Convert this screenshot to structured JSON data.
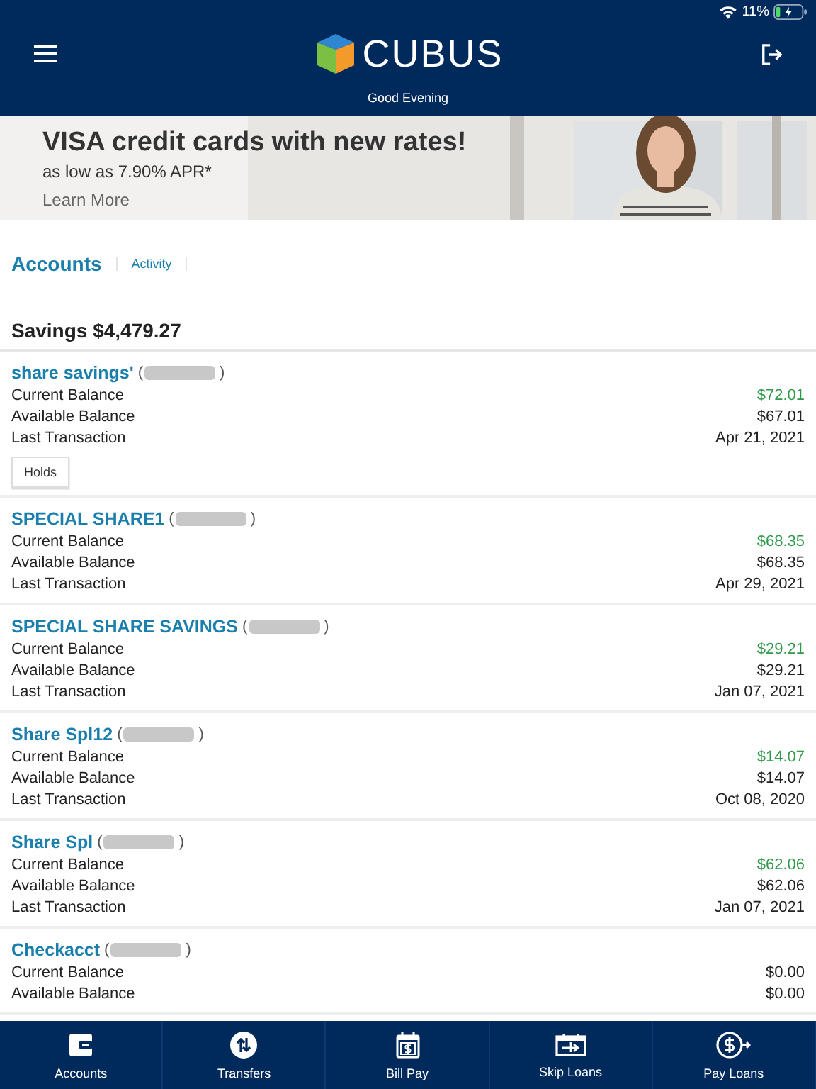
{
  "status_bar": {
    "battery": "11%"
  },
  "header": {
    "logo_text": "CUBUS",
    "greeting": "Good Evening"
  },
  "banner": {
    "headline": "VISA credit cards with new rates!",
    "subline": "as low as 7.90% APR*",
    "link": "Learn More",
    "kind": "picture"
  },
  "tabs": [
    {
      "label": "Accounts",
      "selected": true
    },
    {
      "label": "Activity",
      "selected": false
    }
  ],
  "section_title": "Savings $4,479.27",
  "accounts": [
    {
      "name": "share savings'",
      "open": "(",
      "close": ")",
      "rows": [
        {
          "label": "Current Balance",
          "value": "$72.01",
          "positive": true
        },
        {
          "label": "Available Balance",
          "value": "$67.01",
          "positive": false
        },
        {
          "label": "Last Transaction",
          "value": "Apr 21, 2021",
          "positive": false
        }
      ],
      "button": "Holds"
    },
    {
      "name": "SPECIAL SHARE1",
      "open": "(",
      "close": ")",
      "rows": [
        {
          "label": "Current Balance",
          "value": "$68.35",
          "positive": true
        },
        {
          "label": "Available Balance",
          "value": "$68.35",
          "positive": false
        },
        {
          "label": "Last Transaction",
          "value": "Apr 29, 2021",
          "positive": false
        }
      ]
    },
    {
      "name": "SPECIAL SHARE SAVINGS",
      "open": "(",
      "close": ")",
      "rows": [
        {
          "label": "Current Balance",
          "value": "$29.21",
          "positive": true
        },
        {
          "label": "Available Balance",
          "value": "$29.21",
          "positive": false
        },
        {
          "label": "Last Transaction",
          "value": "Jan 07, 2021",
          "positive": false
        }
      ]
    },
    {
      "name": "Share Spl12",
      "open": "(",
      "close": ")",
      "rows": [
        {
          "label": "Current Balance",
          "value": "$14.07",
          "positive": true
        },
        {
          "label": "Available Balance",
          "value": "$14.07",
          "positive": false
        },
        {
          "label": "Last Transaction",
          "value": "Oct 08, 2020",
          "positive": false
        }
      ]
    },
    {
      "name": "Share Spl",
      "open": "(",
      "close": ")",
      "rows": [
        {
          "label": "Current Balance",
          "value": "$62.06",
          "positive": true
        },
        {
          "label": "Available Balance",
          "value": "$62.06",
          "positive": false
        },
        {
          "label": "Last Transaction",
          "value": "Jan 07, 2021",
          "positive": false
        }
      ]
    },
    {
      "name": "Checkacct",
      "open": "(",
      "close": ")",
      "rows": [
        {
          "label": "Current Balance",
          "value": "$0.00",
          "positive": false
        },
        {
          "label": "Available Balance",
          "value": "$0.00",
          "positive": false
        }
      ]
    }
  ],
  "bottom_nav": [
    {
      "label": "Accounts",
      "kind": "wallet"
    },
    {
      "label": "Transfers",
      "kind": "transfer"
    },
    {
      "label": "Bill Pay",
      "kind": "bill"
    },
    {
      "label": "Skip Loans",
      "kind": "skip"
    },
    {
      "label": "Pay Loans",
      "kind": "payloan"
    }
  ]
}
